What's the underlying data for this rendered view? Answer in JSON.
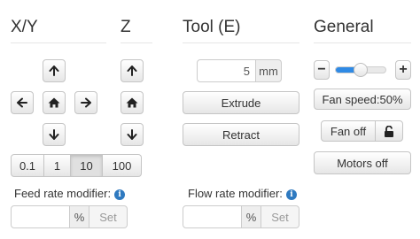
{
  "xy": {
    "heading": "X/Y",
    "step_options": [
      "0.1",
      "1",
      "10",
      "100"
    ],
    "selected_step": "10",
    "feed_rate": {
      "label": "Feed rate modifier:",
      "value": "",
      "unit": "%",
      "set_label": "Set"
    }
  },
  "z": {
    "heading": "Z"
  },
  "tool": {
    "heading": "Tool (E)",
    "amount_value": "5",
    "amount_unit": "mm",
    "extrude_label": "Extrude",
    "retract_label": "Retract",
    "flow_rate": {
      "label": "Flow rate modifier:",
      "value": "",
      "unit": "%",
      "set_label": "Set"
    }
  },
  "general": {
    "heading": "General",
    "minus_label": "−",
    "plus_label": "+",
    "fan_speed_percent": 50,
    "fan_speed_label": "Fan speed:50%",
    "fan_off_label": "Fan off",
    "motors_off_label": "Motors off"
  },
  "info_glyph": "i",
  "icons": {
    "up": "arrow-up-icon",
    "down": "arrow-down-icon",
    "left": "arrow-left-icon",
    "right": "arrow-right-icon",
    "home": "home-icon",
    "unlock": "unlock-icon",
    "info": "info-icon"
  },
  "colors": {
    "accent": "#2f8ae5",
    "info": "#2f7ac0"
  }
}
